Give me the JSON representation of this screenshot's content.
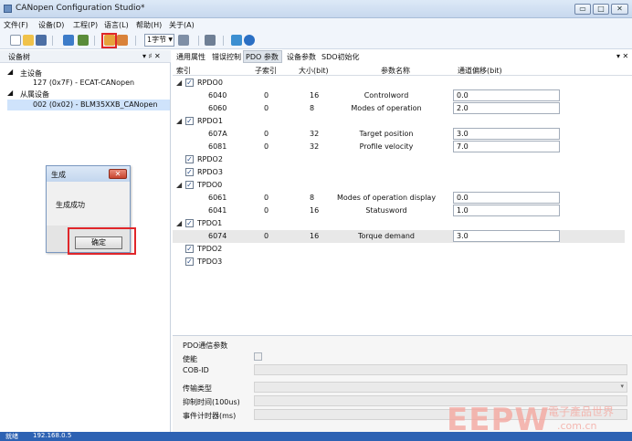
{
  "window": {
    "title": "CANopen Configuration Studio*",
    "minimize_glyph": "▭",
    "maximize_glyph": "□",
    "close_glyph": "✕"
  },
  "menu": [
    "文件(F)",
    "设备(D)",
    "工程(P)",
    "语言(L)",
    "帮助(H)",
    "关于(A)"
  ],
  "toolbar": {
    "combo_value": "1字节",
    "combo_arrow": "▼"
  },
  "device_tree": {
    "header": "设备树",
    "header_icons": "▾ ♯ ✕",
    "master_label": "主设备",
    "master_node": "127 (0x7F)  -  ECAT-CANopen",
    "slave_label": "从属设备",
    "slave_node": "002 (0x02)  -  BLM35XXB_CANopen"
  },
  "dialog": {
    "title": "生成",
    "close": "✕",
    "message": "生成成功",
    "ok": "确定"
  },
  "tabs": [
    "通用属性",
    "错误控制",
    "PDO 参数",
    "设备参数",
    "SDO初始化"
  ],
  "tabs_close": "▾ ✕",
  "pdo_table": {
    "columns": [
      "索引",
      "子索引",
      "大小(bit)",
      "参数名称",
      "通道偏移(bit)"
    ],
    "rows": [
      {
        "group": "RPDO0",
        "expanded": true,
        "items": [
          {
            "index": "6040",
            "sub": "0",
            "size": "16",
            "name": "Controlword",
            "offset": "0.0"
          },
          {
            "index": "6060",
            "sub": "0",
            "size": "8",
            "name": "Modes of operation",
            "offset": "2.0"
          }
        ]
      },
      {
        "group": "RPDO1",
        "expanded": true,
        "items": [
          {
            "index": "607A",
            "sub": "0",
            "size": "32",
            "name": "Target position",
            "offset": "3.0"
          },
          {
            "index": "6081",
            "sub": "0",
            "size": "32",
            "name": "Profile velocity",
            "offset": "7.0"
          }
        ]
      },
      {
        "group": "RPDO2",
        "expanded": false,
        "items": []
      },
      {
        "group": "RPDO3",
        "expanded": false,
        "items": []
      },
      {
        "group": "TPDO0",
        "expanded": true,
        "items": [
          {
            "index": "6061",
            "sub": "0",
            "size": "8",
            "name": "Modes of operation display",
            "offset": "0.0"
          },
          {
            "index": "6041",
            "sub": "0",
            "size": "16",
            "name": "Statusword",
            "offset": "1.0"
          }
        ]
      },
      {
        "group": "TPDO1",
        "expanded": true,
        "items": [
          {
            "index": "6074",
            "sub": "0",
            "size": "16",
            "name": "Torque demand",
            "offset": "3.0",
            "highlight": true
          }
        ]
      },
      {
        "group": "TPDO2",
        "expanded": false,
        "items": []
      },
      {
        "group": "TPDO3",
        "expanded": false,
        "items": []
      }
    ]
  },
  "pdo_comm": {
    "title": "PDO通信参数",
    "labels": [
      "使能",
      "COB-ID",
      "传输类型",
      "抑制时间(100us)",
      "事件计时器(ms)"
    ],
    "dropdown_arrow": "▾"
  },
  "status": {
    "left": "就绪",
    "right": "192.168.0.5"
  },
  "watermark": {
    "brand": "EEPW",
    "slogan": "電子產品世界",
    "url": ".com.cn"
  },
  "colors": {
    "highlight_red": "#e0262a",
    "selection": "#cfe3fb",
    "status_blue": "#2d62b3"
  }
}
